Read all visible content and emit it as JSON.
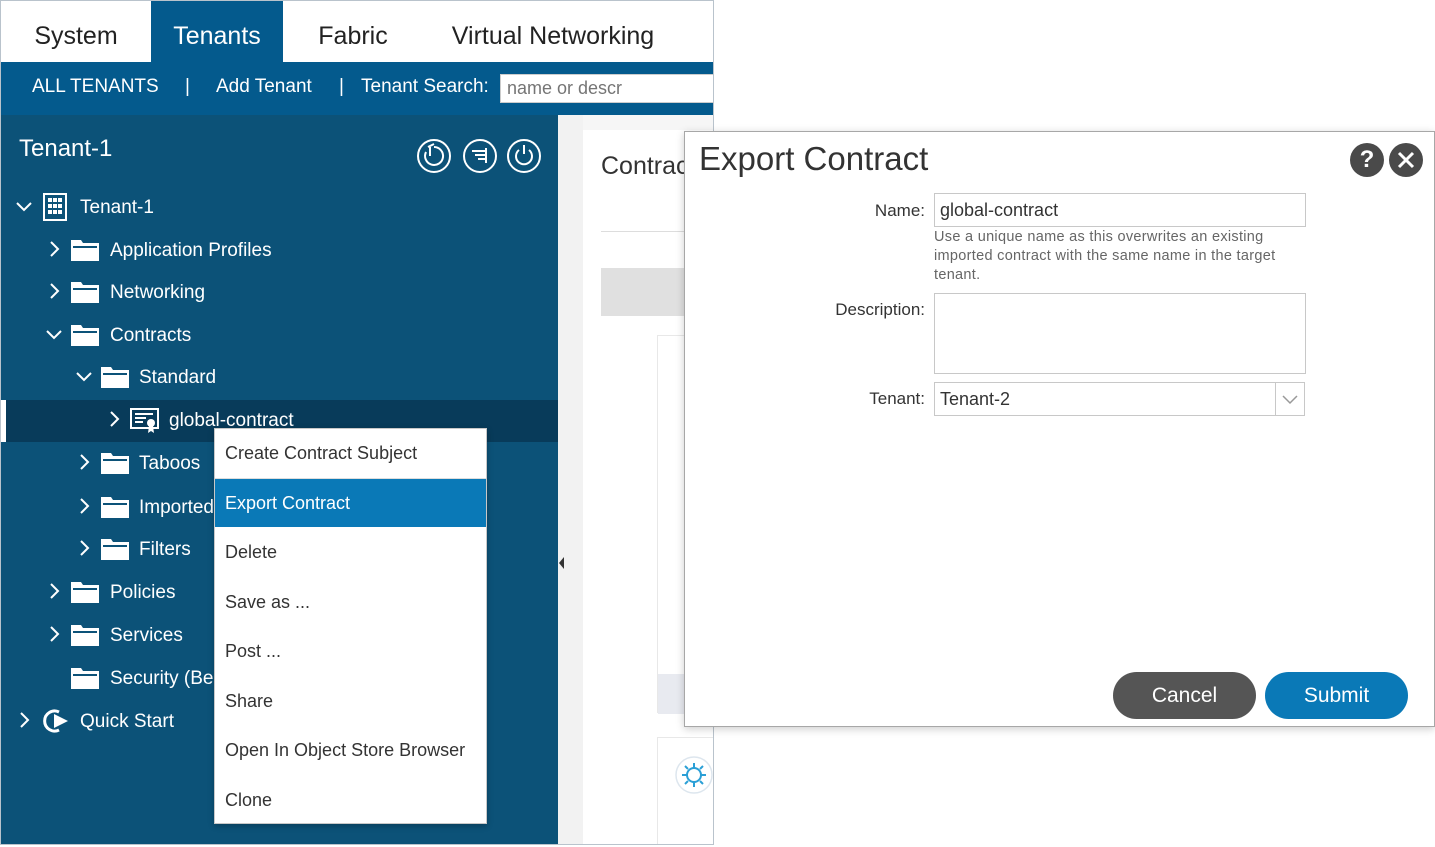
{
  "nav": {
    "tabs": [
      {
        "label": "System"
      },
      {
        "label": "Tenants"
      },
      {
        "label": "Fabric"
      },
      {
        "label": "Virtual Networking"
      }
    ],
    "active_tab": "Tenants"
  },
  "subnav": {
    "all_tenants": "ALL TENANTS",
    "sep": "|",
    "add_tenant": "Add Tenant",
    "search_label": "Tenant Search:",
    "search_placeholder": "name or descr"
  },
  "sidebar": {
    "title": "Tenant-1",
    "tree": [
      {
        "label": "Tenant-1",
        "icon": "building-icon"
      },
      {
        "label": "Application Profiles",
        "icon": "folder-icon"
      },
      {
        "label": "Networking",
        "icon": "folder-icon"
      },
      {
        "label": "Contracts",
        "icon": "folder-icon"
      },
      {
        "label": "Standard",
        "icon": "folder-icon"
      },
      {
        "label": "global-contract",
        "icon": "contract-icon"
      },
      {
        "label": "Taboos",
        "icon": "folder-icon"
      },
      {
        "label": "Imported",
        "icon": "folder-icon"
      },
      {
        "label": "Filters",
        "icon": "folder-icon"
      },
      {
        "label": "Policies",
        "icon": "folder-icon"
      },
      {
        "label": "Services",
        "icon": "folder-icon"
      },
      {
        "label": "Security (Be",
        "icon": "folder-icon"
      },
      {
        "label": "Quick Start",
        "icon": "quick-start-icon"
      }
    ]
  },
  "content": {
    "title": "Contrac"
  },
  "context_menu": {
    "items": [
      {
        "label": "Create Contract Subject"
      },
      {
        "label": "Export Contract"
      },
      {
        "label": "Delete"
      },
      {
        "label": "Save as ..."
      },
      {
        "label": "Post ..."
      },
      {
        "label": "Share"
      },
      {
        "label": "Open In Object Store Browser"
      },
      {
        "label": "Clone"
      }
    ],
    "highlighted": "Export Contract"
  },
  "dialog": {
    "title": "Export Contract",
    "name_label": "Name:",
    "name_value": "global-contract",
    "name_hint": "Use a unique name as this overwrites an existing imported contract with the same name in the target tenant.",
    "description_label": "Description:",
    "description_value": "",
    "tenant_label": "Tenant:",
    "tenant_value": "Tenant-2",
    "cancel_label": "Cancel",
    "submit_label": "Submit"
  },
  "colors": {
    "nav_blue": "#045a8d",
    "sidebar_blue": "#0c5278",
    "selected_row": "#083b5a",
    "menu_highlight": "#0a79b7",
    "submit_blue": "#0a79b7",
    "cancel_gray": "#555555"
  }
}
